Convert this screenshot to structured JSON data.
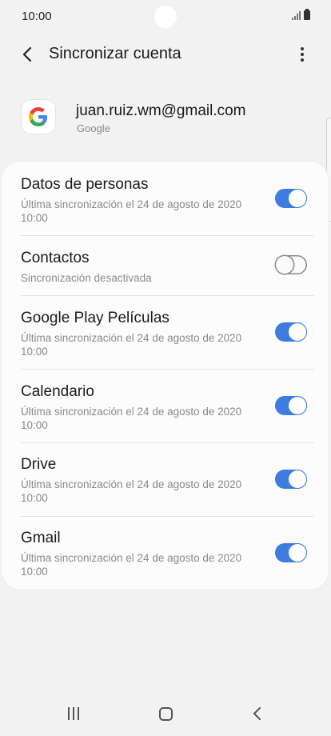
{
  "status_bar": {
    "time": "10:00"
  },
  "app_bar": {
    "title": "Sincronizar cuenta"
  },
  "account": {
    "email": "juan.ruiz.wm@gmail.com",
    "type": "Google"
  },
  "sync_items": [
    {
      "title": "Datos de personas",
      "subtitle": "Última sincronización el 24 de agosto de 2020 10:00",
      "enabled": true
    },
    {
      "title": "Contactos",
      "subtitle": "Sincronización desactivada",
      "enabled": false
    },
    {
      "title": "Google Play Películas",
      "subtitle": "Última sincronización el 24 de agosto de 2020 10:00",
      "enabled": true
    },
    {
      "title": "Calendario",
      "subtitle": "Última sincronización el 24 de agosto de 2020 10:00",
      "enabled": true
    },
    {
      "title": "Drive",
      "subtitle": "Última sincronización el 24 de agosto de 2020 10:00",
      "enabled": true
    },
    {
      "title": "Gmail",
      "subtitle": "Última sincronización el 24 de agosto de 2020 10:00",
      "enabled": true
    }
  ],
  "colors": {
    "accent": "#3d7ce0",
    "background": "#f2f2f2",
    "card": "#fcfcfc"
  },
  "icons": {
    "back": "back-arrow-icon",
    "more": "more-vert-icon",
    "logo": "google-logo-icon",
    "nav_recents": "recents-icon",
    "nav_home": "home-icon",
    "nav_back": "back-icon"
  }
}
